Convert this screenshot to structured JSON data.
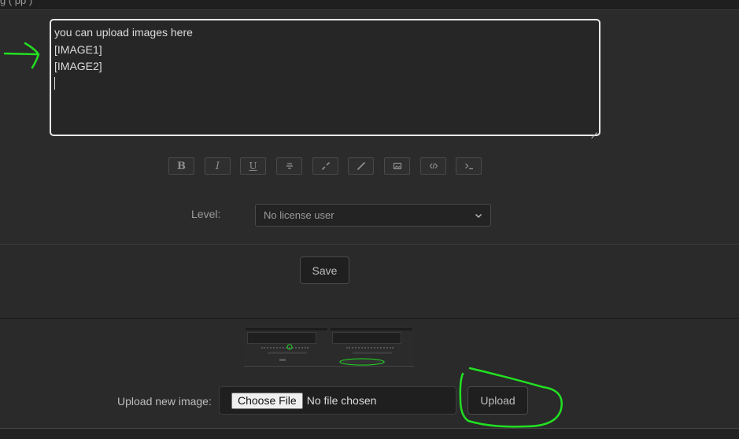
{
  "header": {
    "partial_title": "g      (                                 pp  )"
  },
  "editor": {
    "lines": [
      "you can upload images here",
      "[IMAGE1]",
      "[IMAGE2]"
    ]
  },
  "toolbar": {
    "buttons": [
      {
        "icon": "bold-icon",
        "glyph": "B"
      },
      {
        "icon": "italic-icon",
        "glyph": "I"
      },
      {
        "icon": "underline-icon",
        "glyph": "U"
      },
      {
        "icon": "strikethrough-icon",
        "glyph": "S"
      },
      {
        "icon": "link-icon",
        "glyph": ""
      },
      {
        "icon": "unlink-icon",
        "glyph": ""
      },
      {
        "icon": "image-icon",
        "glyph": ""
      },
      {
        "icon": "code-icon",
        "glyph": ""
      },
      {
        "icon": "terminal-icon",
        "glyph": ""
      }
    ]
  },
  "level": {
    "label": "Level:",
    "selected": "No license user"
  },
  "save": {
    "label": "Save"
  },
  "upload": {
    "label": "Upload new image:",
    "choose_label": "Choose File",
    "file_status": "No file chosen",
    "button_label": "Upload"
  },
  "colors": {
    "annotation": "#22e022",
    "background": "#2a2a2a",
    "textarea_border": "#e8e8e8"
  }
}
